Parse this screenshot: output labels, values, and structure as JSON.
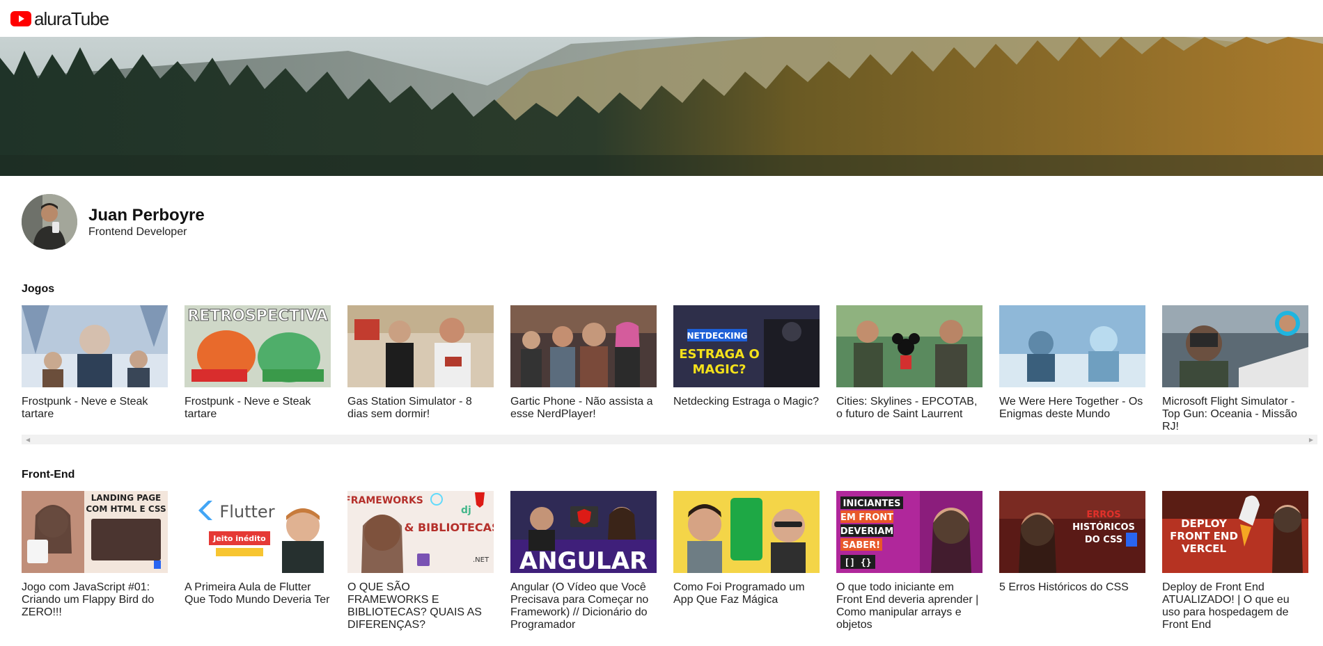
{
  "header": {
    "logo_text": "aluraTube",
    "logo_icon": "youtube-play-icon",
    "brand_color": "#ff0000"
  },
  "profile": {
    "name": "Juan Perboyre",
    "job": "Frontend Developer"
  },
  "playlists": [
    {
      "title": "Jogos",
      "videos": [
        {
          "title": "Frostpunk - Neve e Steak tartare"
        },
        {
          "title": "Frostpunk - Neve e Steak tartare",
          "thumb_text": "RETROSPECTIVA"
        },
        {
          "title": "Gas Station Simulator - 8 dias sem dormir!"
        },
        {
          "title": "Gartic Phone - Não assista a esse NerdPlayer!"
        },
        {
          "title": "Netdecking Estraga o Magic?",
          "thumb_text_1": "NETDECKING",
          "thumb_text_2": "ESTRAGA O",
          "thumb_text_3": "MAGIC?"
        },
        {
          "title": "Cities: Skylines - EPCOTAB, o futuro de Saint Laurrent"
        },
        {
          "title": "We Were Here Together - Os Enigmas deste Mundo"
        },
        {
          "title": "Microsoft Flight Simulator - Top Gun: Oceania - Missão RJ!"
        }
      ]
    },
    {
      "title": "Front-End",
      "videos": [
        {
          "title": "Jogo com JavaScript #01: Criando um Flappy Bird do ZERO!!!",
          "thumb_text_1": "LANDING PAGE",
          "thumb_text_2": "COM HTML E CSS"
        },
        {
          "title": "A Primeira Aula de Flutter Que Todo Mundo Deveria Ter",
          "thumb_text_1": "Flutter",
          "thumb_text_2": "Jeito inédito"
        },
        {
          "title": "O QUE SÃO FRAMEWORKS E BIBLIOTECAS? QUAIS AS DIFERENÇAS?",
          "thumb_text_1": "FRAMEWORKS",
          "thumb_text_2": "& BIBLIOTECAS",
          "thumb_text_3": "dj",
          "thumb_text_4": ".NET"
        },
        {
          "title": "Angular (O Vídeo que Você Precisava para Começar no Framework) // Dicionário do Programador",
          "thumb_text_1": "ANGULAR"
        },
        {
          "title": "Como Foi Programado um App Que Faz Mágica"
        },
        {
          "title": "O que todo iniciante em Front End deveria aprender | Como manipular arrays e objetos",
          "thumb_text_1": "INICIANTES",
          "thumb_text_2": "EM FRONT",
          "thumb_text_3": "DEVERIAM",
          "thumb_text_4": "SABER!",
          "thumb_text_5": "[] {}"
        },
        {
          "title": "5 Erros Históricos do CSS",
          "thumb_text_1": "ERROS",
          "thumb_text_2": "HISTÓRICOS",
          "thumb_text_3": "DO CSS"
        },
        {
          "title": "Deploy de Front End ATUALIZADO! | O que eu uso para hospedagem de Front End",
          "thumb_text_1": "DEPLOY",
          "thumb_text_2": "FRONT END",
          "thumb_text_3": "VERCEL"
        }
      ]
    }
  ]
}
